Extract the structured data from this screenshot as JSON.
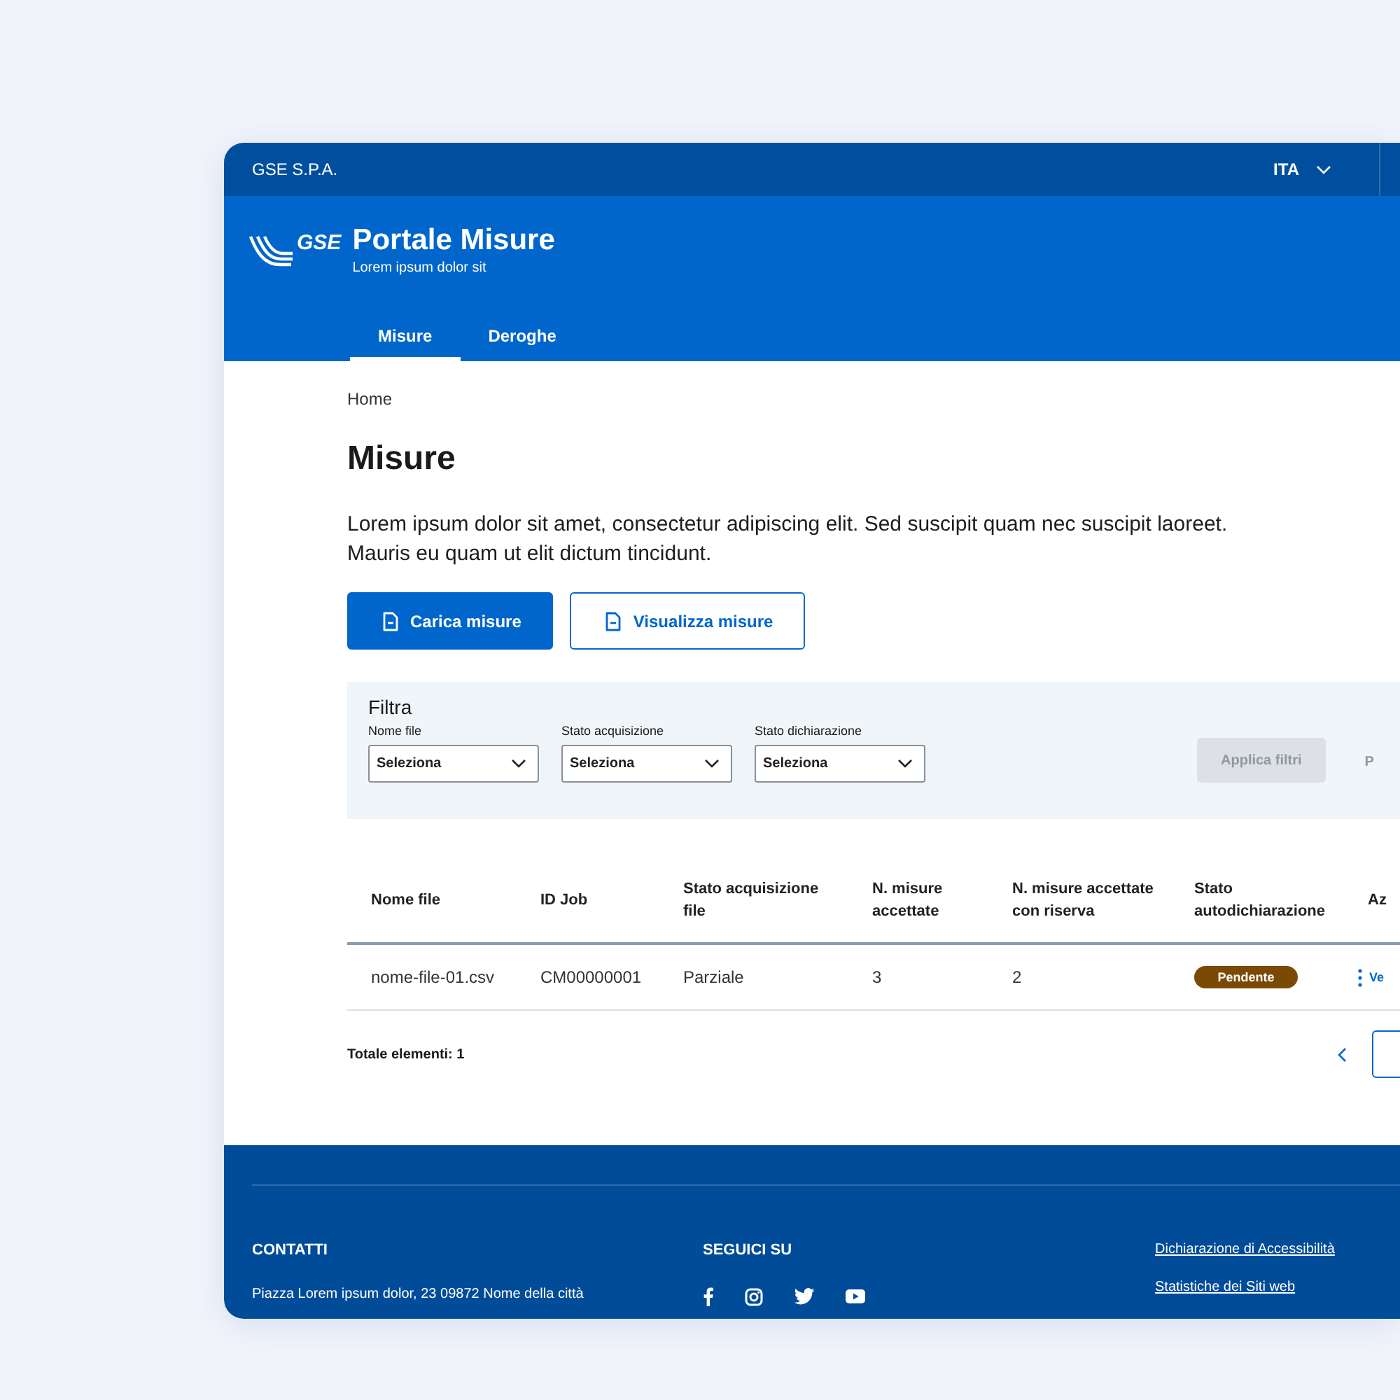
{
  "top_bar": {
    "company": "GSE S.P.A.",
    "language": "ITA"
  },
  "header": {
    "logo_text": "GSE",
    "title": "Portale Misure",
    "subtitle": "Lorem ipsum dolor sit"
  },
  "nav_tabs": [
    {
      "label": "Misure",
      "selected": true
    },
    {
      "label": "Deroghe",
      "selected": false
    }
  ],
  "breadcrumb": "Home",
  "page": {
    "title": "Misure",
    "description": "Lorem ipsum dolor sit amet, consectetur adipiscing elit. Sed suscipit quam nec suscipit laoreet. Mauris eu quam ut elit dictum tincidunt."
  },
  "actions": [
    {
      "label": "Carica misure",
      "kind": "primary"
    },
    {
      "label": "Visualizza misure",
      "kind": "secondary"
    }
  ],
  "filter": {
    "title": "Filtra",
    "fields": [
      {
        "label": "Nome file",
        "placeholder": "Seleziona"
      },
      {
        "label": "Stato acquisizione",
        "placeholder": "Seleziona"
      },
      {
        "label": "Stato dichiarazione",
        "placeholder": "Seleziona"
      }
    ],
    "apply_button": {
      "label": "Applica filtri",
      "disabled": true
    },
    "reset_button": "P"
  },
  "table": {
    "columns": [
      "Nome file",
      "ID Job",
      "Stato acquisizione file",
      "N. misure accettate",
      "N. misure accettate con riserva",
      "Stato autodichiarazione",
      "Az"
    ],
    "rows": [
      {
        "cells": [
          "nome-file-01.csv",
          "CM00000001",
          "Parziale",
          "3",
          "2"
        ],
        "status": {
          "label": "Pendente",
          "color": "#7a4a05"
        },
        "action": "Ve"
      }
    ]
  },
  "total": "Totale elementi: 1",
  "footer": {
    "columns": [
      {
        "title": "CONTATTI",
        "text": "Piazza Lorem ipsum dolor, 23 09872 Nome della città"
      },
      {
        "title": "SEGUICI SU"
      }
    ],
    "links": [
      "Dichiarazione di Accessibilità",
      "Statistiche dei Siti web"
    ]
  }
}
